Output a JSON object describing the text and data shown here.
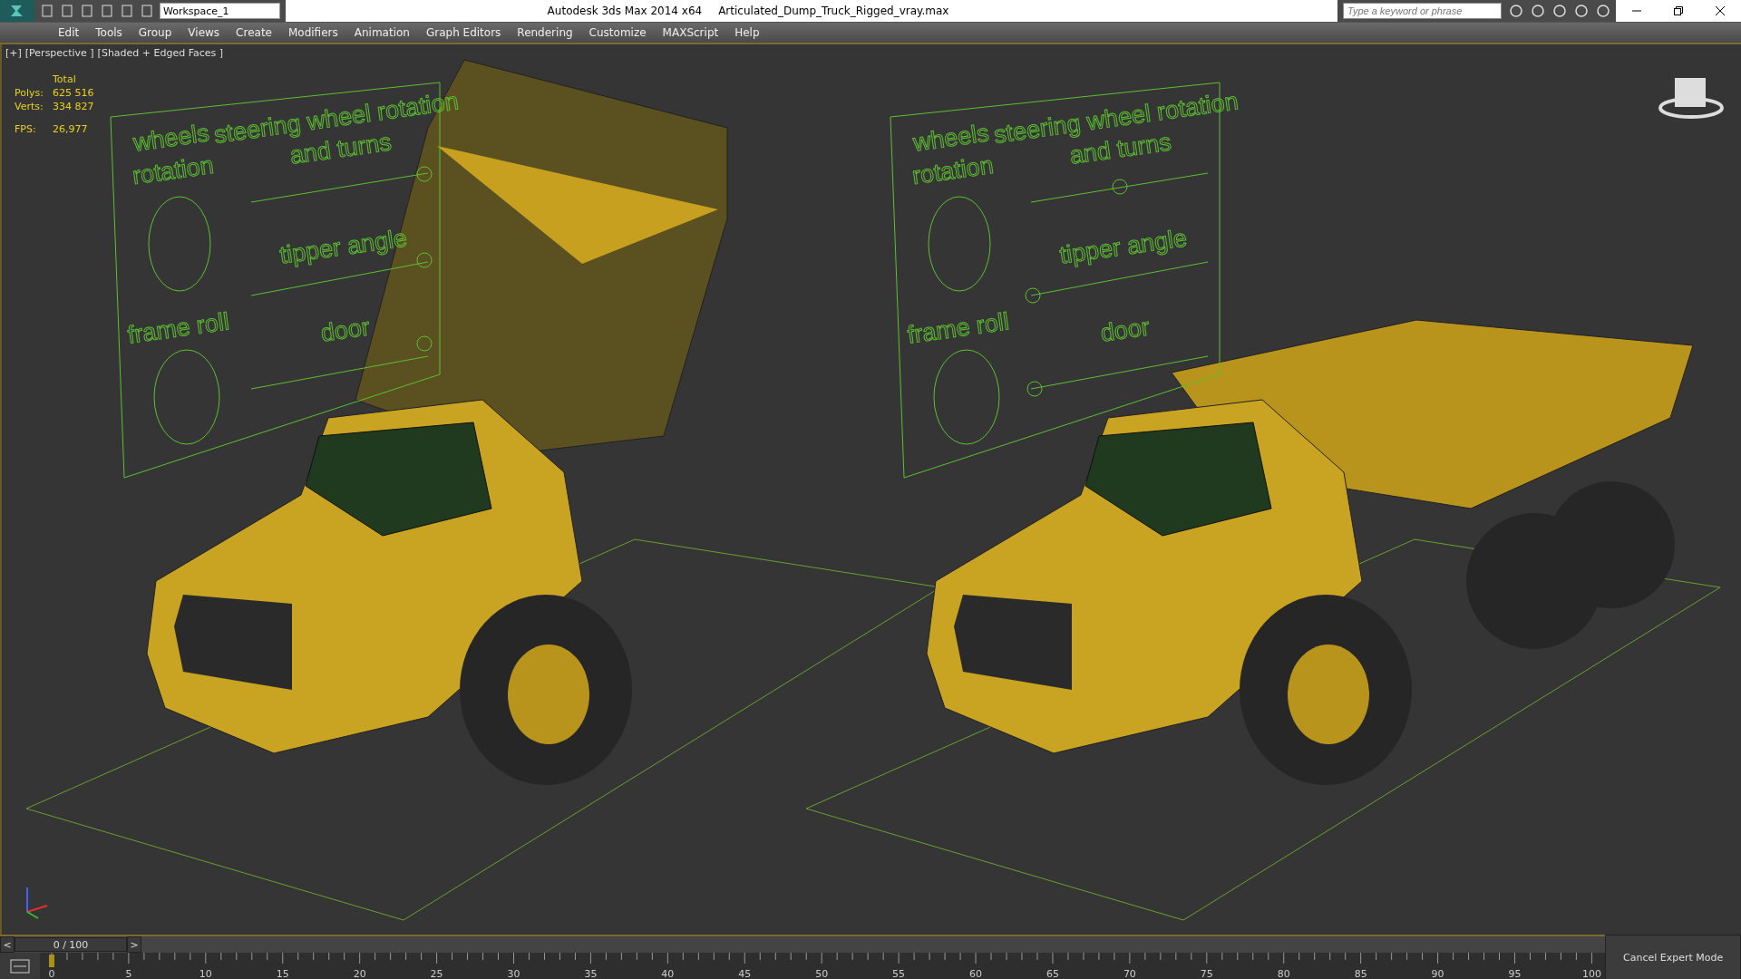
{
  "title_bar": {
    "workspace": "Workspace_1",
    "app_title": "Autodesk 3ds Max  2014 x64",
    "file_name": "Articulated_Dump_Truck_Rigged_vray.max",
    "search": {
      "placeholder": "Type a keyword or phrase"
    }
  },
  "menu": [
    "Edit",
    "Tools",
    "Group",
    "Views",
    "Create",
    "Modifiers",
    "Animation",
    "Graph Editors",
    "Rendering",
    "Customize",
    "MAXScript",
    "Help"
  ],
  "viewport": {
    "labels": [
      "[+]",
      "[Perspective ]",
      "[Shaded + Edged Faces ]"
    ],
    "stats": {
      "heading": "Total",
      "rows": [
        {
          "label": "Polys:",
          "value": "625 516"
        },
        {
          "label": "Verts:",
          "value": "334 827"
        },
        {
          "label": "FPS:",
          "value": "26,977"
        }
      ]
    },
    "panels": [
      {
        "wheels": "wheels",
        "rotation": "rotation",
        "steering_1": "steering wheel rotation",
        "steering_2": "and turns",
        "tipper": "tipper angle",
        "frame_roll": "frame roll",
        "door": "door"
      },
      {
        "wheels": "wheels",
        "rotation": "rotation",
        "steering_1": "steering wheel rotation",
        "steering_2": "and turns",
        "tipper": "tipper angle",
        "frame_roll": "frame roll",
        "door": "door"
      }
    ],
    "trucks": [
      {
        "kind": "raised"
      },
      {
        "kind": "lowered"
      }
    ]
  },
  "time_slider": {
    "prev": "<",
    "next": ">",
    "frame": "0 / 100",
    "level": 0
  },
  "track": {
    "ticks": [
      "0",
      "5",
      "10",
      "15",
      "20",
      "25",
      "30",
      "35",
      "40",
      "45",
      "50",
      "55",
      "60",
      "65",
      "70",
      "75",
      "80",
      "85",
      "90",
      "95",
      "100"
    ]
  },
  "expert_button": "Cancel Expert Mode"
}
